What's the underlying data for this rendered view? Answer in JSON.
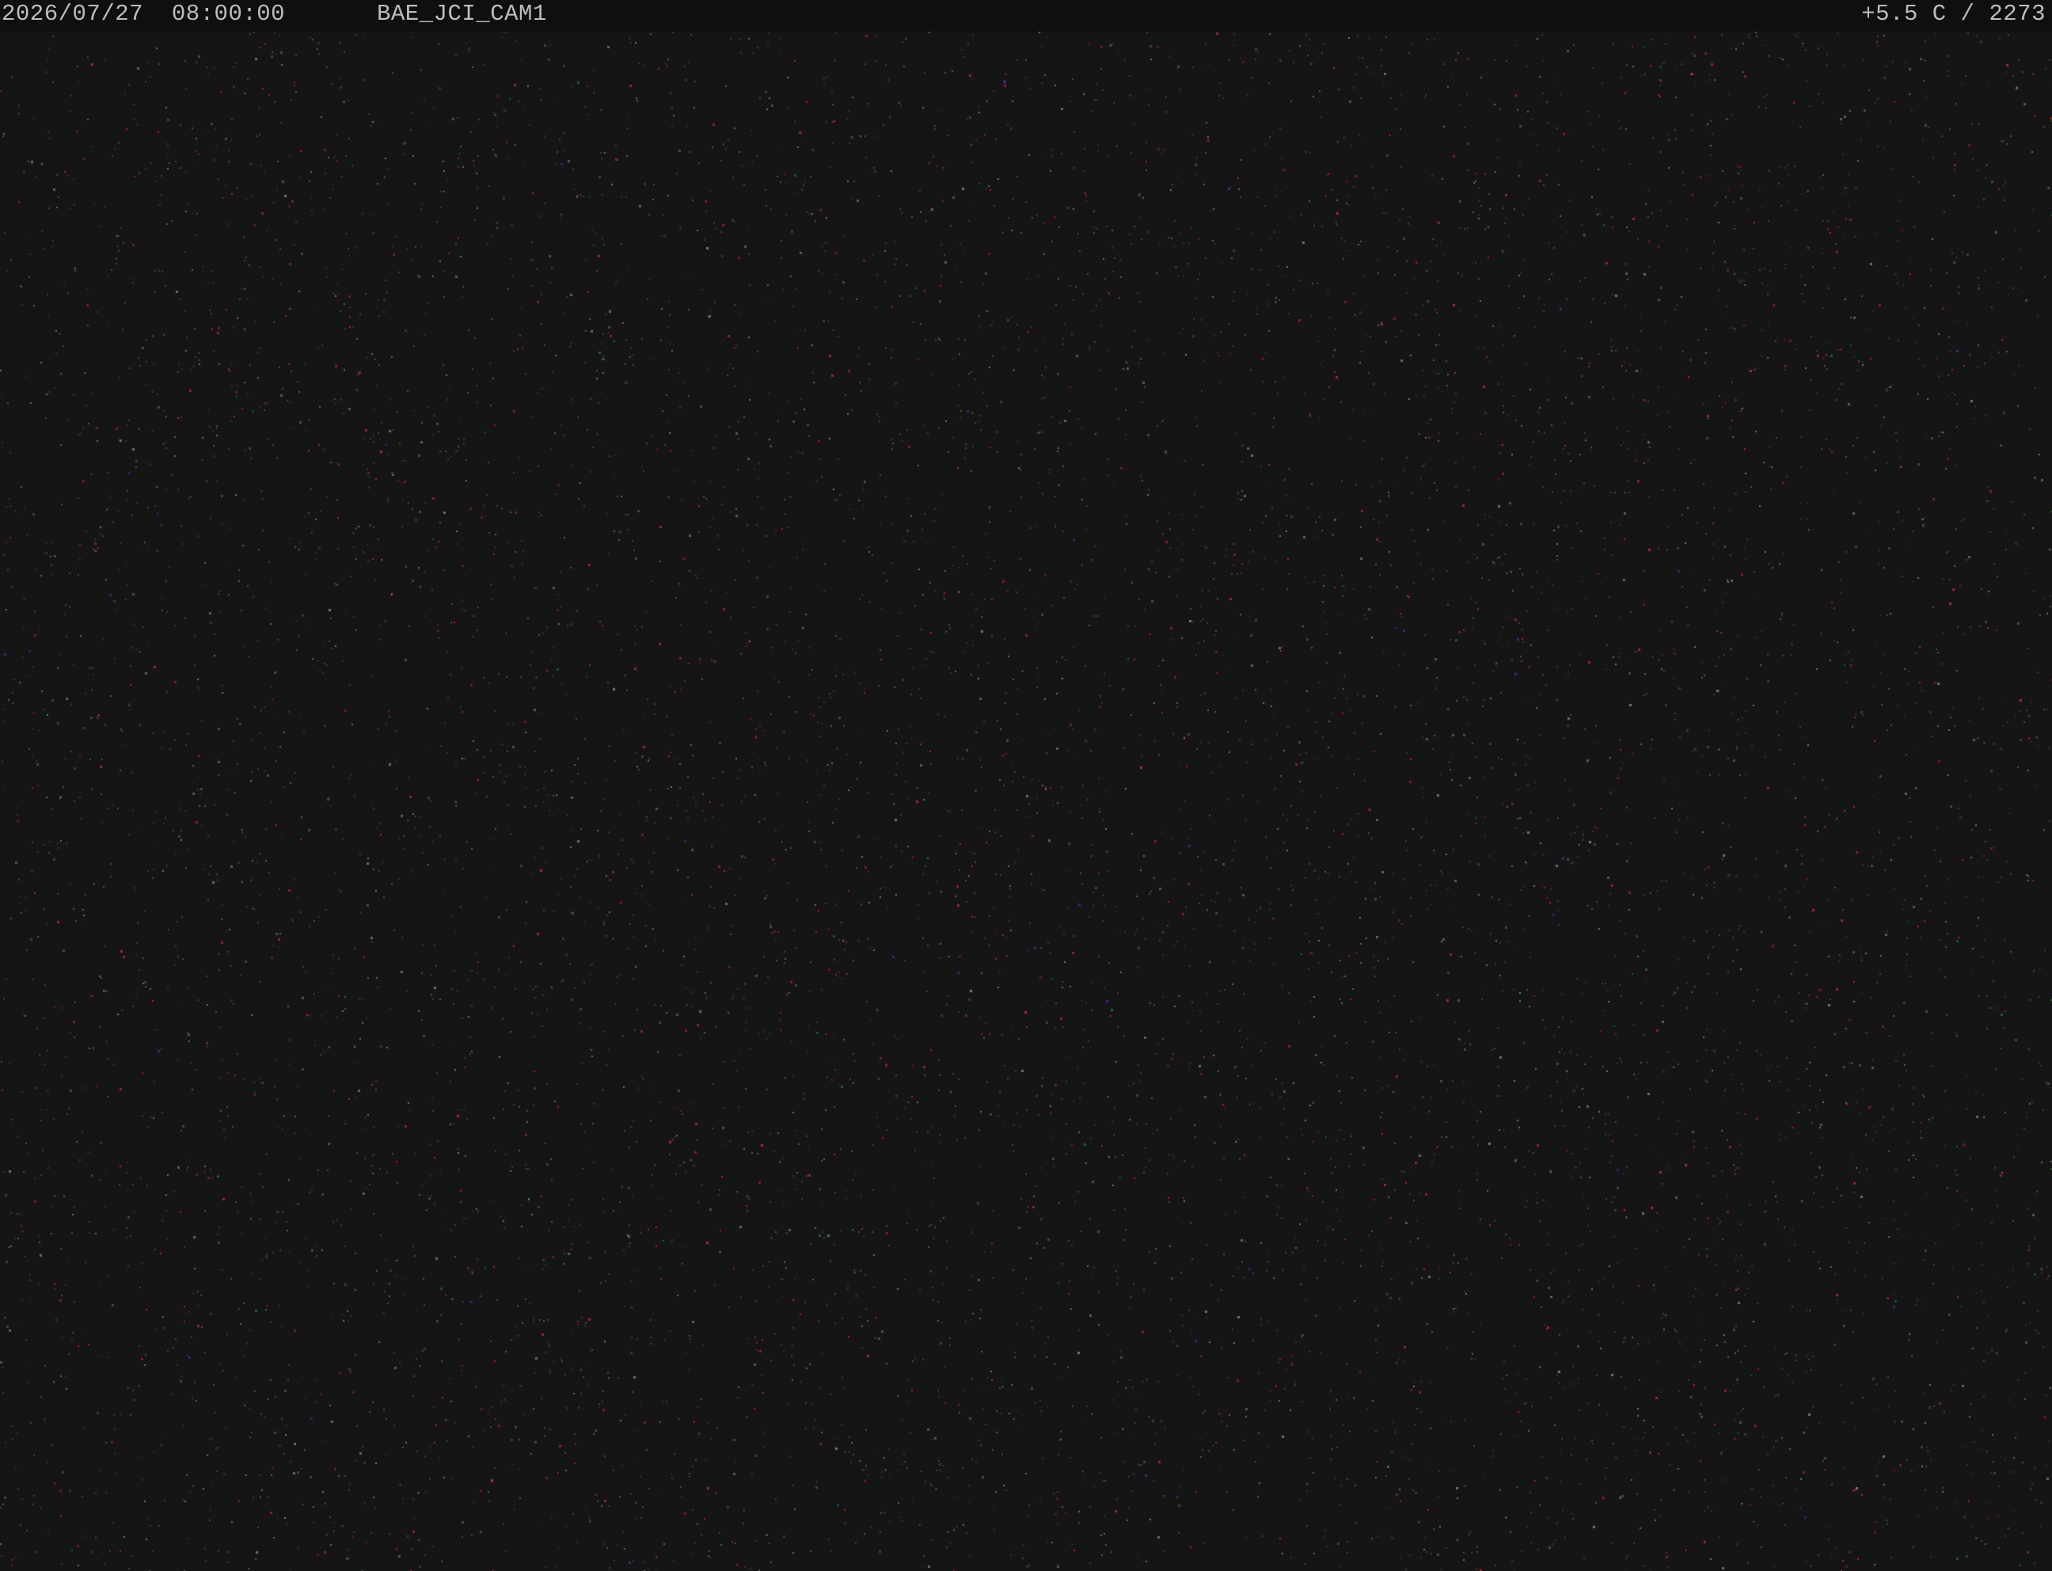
{
  "osd": {
    "date": "2026/07/27",
    "time": "08:00:00",
    "camera_name": "BAE_JCI_CAM1",
    "temperature": "+5.5 C",
    "frame_counter": "2273"
  },
  "feed": {
    "background_color": "#151515",
    "noise_colors": [
      "#c0303a",
      "#7a2a40",
      "#3a3a8a",
      "#3a6a3a",
      "#8a8a8a"
    ]
  }
}
